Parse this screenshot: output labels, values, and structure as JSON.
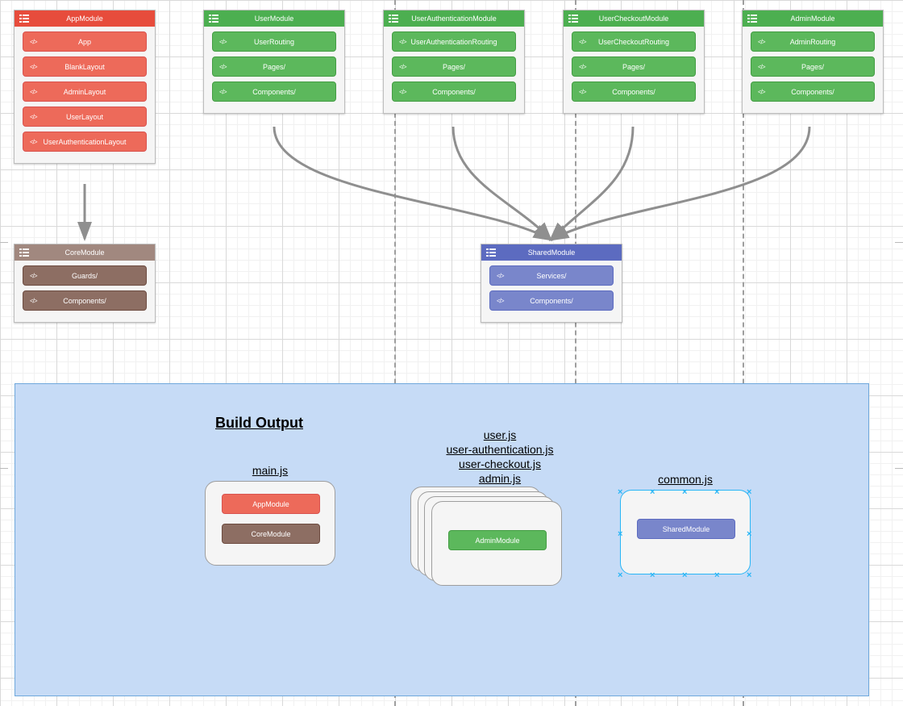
{
  "dashed_x": [
    489,
    713,
    921
  ],
  "modules": {
    "app": {
      "title": "AppModule",
      "items": [
        "App",
        "BlankLayout",
        "AdminLayout",
        "UserLayout",
        "UserAuthenticationLayout"
      ]
    },
    "core": {
      "title": "CoreModule",
      "items": [
        "Guards/",
        "Components/"
      ]
    },
    "user": {
      "title": "UserModule",
      "items": [
        "UserRouting",
        "Pages/",
        "Components/"
      ]
    },
    "auth": {
      "title": "UserAuthenticationModule",
      "items": [
        "UserAuthenticationRouting",
        "Pages/",
        "Components/"
      ]
    },
    "check": {
      "title": "UserCheckoutModule",
      "items": [
        "UserCheckoutRouting",
        "Pages/",
        "Components/"
      ]
    },
    "admin": {
      "title": "AdminModule",
      "items": [
        "AdminRouting",
        "Pages/",
        "Components/"
      ]
    },
    "shared": {
      "title": "SharedModule",
      "items": [
        "Services/",
        "Components/"
      ]
    }
  },
  "build": {
    "title": "Build Output",
    "main_label": "main.js",
    "main_items": [
      "AppModule",
      "CoreModule"
    ],
    "stack_files": [
      "user.js",
      "user-authentication.js",
      "user-checkout.js",
      "admin.js"
    ],
    "stack_item": "AdminModule",
    "common_label": "common.js",
    "common_item": "SharedModule"
  }
}
